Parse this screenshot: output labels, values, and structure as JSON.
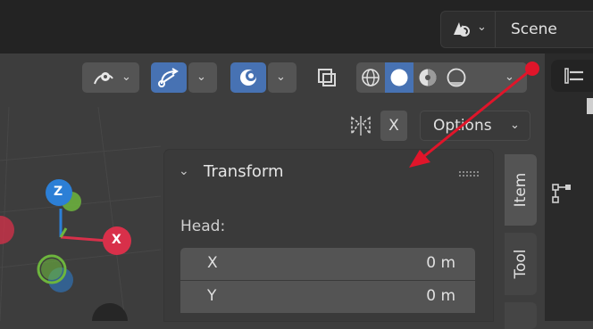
{
  "scene": {
    "label": "Scene",
    "icon": "scene-icon"
  },
  "viewport_header": {
    "buttons": [
      {
        "name": "visibility-eye-icon"
      },
      {
        "name": "gizmo-toggle-icon"
      },
      {
        "name": "overlay-toggle-icon"
      },
      {
        "name": "xray-toggle-icon"
      }
    ],
    "shading_modes": [
      "wireframe",
      "solid",
      "material-preview",
      "rendered"
    ],
    "active_shading": "solid"
  },
  "mirror": {
    "x_label": "X"
  },
  "options": {
    "label": "Options"
  },
  "panel": {
    "section_title": "Transform",
    "head_label": "Head:",
    "fields": [
      {
        "axis": "X",
        "value": "0 m"
      },
      {
        "axis": "Y",
        "value": "0 m"
      }
    ]
  },
  "tabs": [
    {
      "label": "Item",
      "active": true
    },
    {
      "label": "Tool",
      "active": false
    }
  ],
  "gizmo": {
    "z_label": "Z",
    "x_label": "X"
  },
  "colors": {
    "accent_blue": "#4772b3",
    "axis_x": "#d8304a",
    "axis_y": "#6db53d",
    "axis_z": "#2c7fd6",
    "annotation_red": "#e0152a"
  }
}
